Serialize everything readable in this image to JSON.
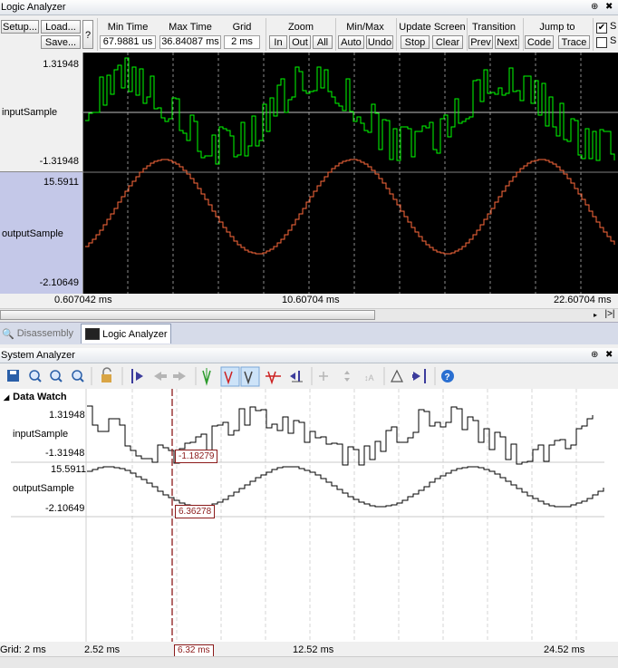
{
  "la": {
    "title": "Logic Analyzer",
    "pin_glyph": "⊕",
    "close_glyph": "✖",
    "setup_label": "Setup...",
    "load_label": "Load...",
    "save_label": "Save...",
    "help_label": "?",
    "min_time_header": "Min Time",
    "min_time_value": "67.9881 us",
    "max_time_header": "Max Time",
    "max_time_value": "36.84087 ms",
    "grid_header": "Grid",
    "grid_value": "2 ms",
    "zoom_header": "Zoom",
    "zoom_in": "In",
    "zoom_out": "Out",
    "zoom_all": "All",
    "minmax_header": "Min/Max",
    "minmax_auto": "Auto",
    "minmax_undo": "Undo",
    "update_header": "Update Screen",
    "update_stop": "Stop",
    "update_clear": "Clear",
    "transition_header": "Transition",
    "transition_prev": "Prev",
    "transition_next": "Next",
    "jump_header": "Jump to",
    "jump_code": "Code",
    "jump_trace": "Trace",
    "check1_label": "S",
    "check2_label": "S",
    "signals": [
      {
        "name": "inputSample",
        "max": "1.31948",
        "min": "-1.31948",
        "color": "#00ff00"
      },
      {
        "name": "outputSample",
        "max": "15.5911",
        "min": "-2.10649",
        "color": "#ff6a3d"
      }
    ],
    "time_axis": [
      "0.607042 ms",
      "10.60704 ms",
      "22.60704 ms"
    ],
    "scroll_end": "|>|"
  },
  "tabs": [
    {
      "label": "Disassembly",
      "active": false
    },
    {
      "label": "Logic Analyzer",
      "active": true
    }
  ],
  "sa": {
    "title": "System Analyzer",
    "section_label": "Data Watch",
    "signals": [
      {
        "name": "inputSample",
        "max": "1.31948",
        "min": "-1.31948",
        "cursor_value": "-1.18279"
      },
      {
        "name": "outputSample",
        "max": "15.5911",
        "min": "-2.10649",
        "cursor_value": "6.36278"
      }
    ],
    "grid_label": "Grid: 2 ms",
    "time_axis": [
      "2.52 ms",
      "12.52 ms",
      "24.52 ms"
    ],
    "cursor_time": "6.32 ms"
  }
}
